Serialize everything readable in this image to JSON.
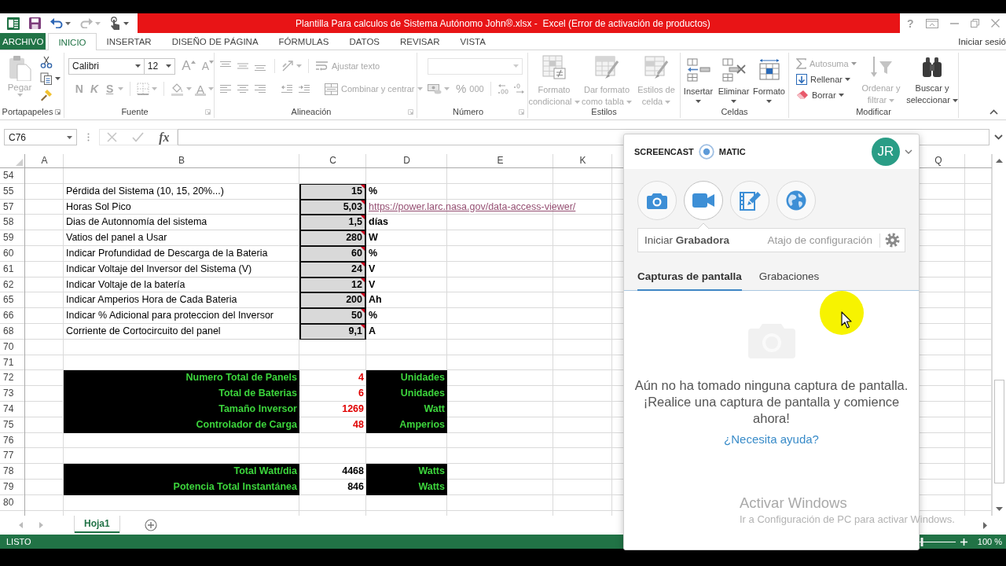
{
  "window": {
    "title": "Plantilla Para calculos de Sistema Autónomo John®.xlsx -  Excel (Error de activación de productos)",
    "help": "?"
  },
  "ribbon_tabs": [
    {
      "label": "ARCHIVO",
      "kind": "file",
      "selected": false
    },
    {
      "label": "INICIO",
      "kind": "tab",
      "selected": true
    },
    {
      "label": "INSERTAR",
      "kind": "tab",
      "selected": false
    },
    {
      "label": "DISEÑO DE PÁGINA",
      "kind": "tab",
      "selected": false
    },
    {
      "label": "FÓRMULAS",
      "kind": "tab",
      "selected": false
    },
    {
      "label": "DATOS",
      "kind": "tab",
      "selected": false
    },
    {
      "label": "REVISAR",
      "kind": "tab",
      "selected": false
    },
    {
      "label": "VISTA",
      "kind": "tab",
      "selected": false
    }
  ],
  "account": {
    "label": "Iniciar sesió"
  },
  "ribbon": {
    "clipboard": {
      "label": "Portapapeles",
      "paste": {
        "label": "Pegar",
        "disabled": true
      }
    },
    "font": {
      "label": "Fuente",
      "font_name": "Calibri",
      "font_size": "12",
      "grow": "A",
      "shrink": "A",
      "bold": "N",
      "italic": "K",
      "underline": "S",
      "paint_letter": "A"
    },
    "alignment": {
      "label": "Alineación",
      "wrap": {
        "label": "Ajustar texto",
        "disabled": true
      },
      "merge": {
        "label": "Combinar y centrar",
        "disabled": true
      }
    },
    "number": {
      "label": "Número",
      "percent": "%",
      "thousands": "000"
    },
    "styles": {
      "label": "Estilos",
      "buttons": [
        {
          "label": "Formato condicional",
          "disabled": true
        },
        {
          "label": "Dar formato como tabla",
          "disabled": true
        },
        {
          "label": "Estilos de celda",
          "disabled": true
        }
      ]
    },
    "cells": {
      "label": "Celdas",
      "buttons": [
        {
          "label": "Insertar",
          "disabled": false
        },
        {
          "label": "Eliminar",
          "disabled": false
        },
        {
          "label": "Formato",
          "disabled": false
        }
      ]
    },
    "editing": {
      "label": "Modificar",
      "buttons": [
        {
          "label": "Autosuma",
          "disabled": true
        },
        {
          "label": "Rellenar",
          "disabled": false
        },
        {
          "label": "Borrar",
          "disabled": false
        },
        {
          "label": "Ordenar y filtrar",
          "disabled": true
        },
        {
          "label": "Buscar y seleccionar",
          "disabled": false
        }
      ]
    }
  },
  "formula_bar": {
    "name_box": "C76",
    "fx": "fx"
  },
  "sheet": {
    "columns": [
      "A",
      "B",
      "C",
      "D",
      "E",
      "K",
      "Q"
    ],
    "rows": [
      {
        "number": "54",
        "kind": "blank"
      },
      {
        "number": "55",
        "kind": "input",
        "label": "Pérdida del Sistema (10, 15, 20%...)",
        "value": "15",
        "unit": "%",
        "comment": true
      },
      {
        "number": "57",
        "kind": "input",
        "label": "Horas Sol Pico",
        "value": "5,03",
        "link": "https://power.larc.nasa.gov/data-access-viewer/",
        "comment": true
      },
      {
        "number": "58",
        "kind": "input",
        "label": "Dias de Autonnomía del sistema",
        "value": "1,5",
        "unit": "días",
        "comment": true
      },
      {
        "number": "59",
        "kind": "input",
        "label": "Vatios del panel a Usar",
        "value": "280",
        "unit": "W",
        "comment": true
      },
      {
        "number": "60",
        "kind": "input",
        "label": "Indicar Profundidad de Descarga de la Bateria",
        "value": "60",
        "unit": "%",
        "comment": true
      },
      {
        "number": "61",
        "kind": "input",
        "label": "Indicar Voltaje del Inversor del Sistema (V)",
        "value": "24",
        "unit": "V",
        "comment": true
      },
      {
        "number": "62",
        "kind": "input",
        "label": "Indicar Voltaje de la batería",
        "value": "12",
        "unit": "V",
        "comment": true
      },
      {
        "number": "65",
        "kind": "input",
        "label": "Indicar Amperios Hora de Cada Bateria",
        "value": "200",
        "unit": "Ah",
        "comment": true
      },
      {
        "number": "66",
        "kind": "input",
        "label": "Indicar % Adicional para proteccion del Inversor",
        "value": "50",
        "unit": "%",
        "comment": true
      },
      {
        "number": "68",
        "kind": "input",
        "label": "Corriente de Cortocircuito del panel",
        "value": "9,1",
        "unit": "A",
        "comment": true
      },
      {
        "number": "70",
        "kind": "blank"
      },
      {
        "number": "71",
        "kind": "blank"
      },
      {
        "number": "72",
        "kind": "result",
        "label": "Numero Total de Panels",
        "value": "4",
        "unit": "Unidades"
      },
      {
        "number": "73",
        "kind": "result",
        "label": "Total de Baterias",
        "value": "6",
        "unit": "Unidades"
      },
      {
        "number": "74",
        "kind": "result",
        "label": "Tamaño Inversor",
        "value": "1269",
        "unit": "Watt"
      },
      {
        "number": "75",
        "kind": "result",
        "label": "Controlador de Carga",
        "value": "48",
        "unit": "Amperios"
      },
      {
        "number": "76",
        "kind": "blank"
      },
      {
        "number": "77",
        "kind": "blank"
      },
      {
        "number": "78",
        "kind": "total",
        "label": "Total Watt/dia",
        "value": "4468",
        "unit": "Watts"
      },
      {
        "number": "79",
        "kind": "total",
        "label": "Potencia Total Instantánea",
        "value": "846",
        "unit": "Watts"
      },
      {
        "number": "80",
        "kind": "blank"
      }
    ]
  },
  "sheet_tabs": [
    {
      "label": "Hoja1",
      "selected": true
    }
  ],
  "status_bar": {
    "mode": "LISTO",
    "zoom": "100 %",
    "zoom_slider": {
      "level": 0.5
    }
  },
  "screencast_panel": {
    "brand": {
      "left": "SCREENCAST",
      "right": "MATIC"
    },
    "avatar": "JR",
    "tools": [
      {
        "selected": false
      },
      {
        "selected": true
      },
      {
        "selected": false
      },
      {
        "selected": false
      }
    ],
    "launch": "Iniciar **Grabadora**",
    "shortcut": "Atajo de configuración",
    "tabs": [
      {
        "label": "Capturas de pantalla",
        "selected": true
      },
      {
        "label": "Grabaciones",
        "selected": false
      }
    ],
    "empty_message": "Aún no ha tomado ninguna captura de pantalla. ¡Realice una captura de pantalla y comience ahora!",
    "help_link": "¿Necesita ayuda?"
  },
  "activation_notice": {
    "title": "Activar Windows",
    "subtitle": "Ir a Configuración de PC para activar Windows."
  }
}
